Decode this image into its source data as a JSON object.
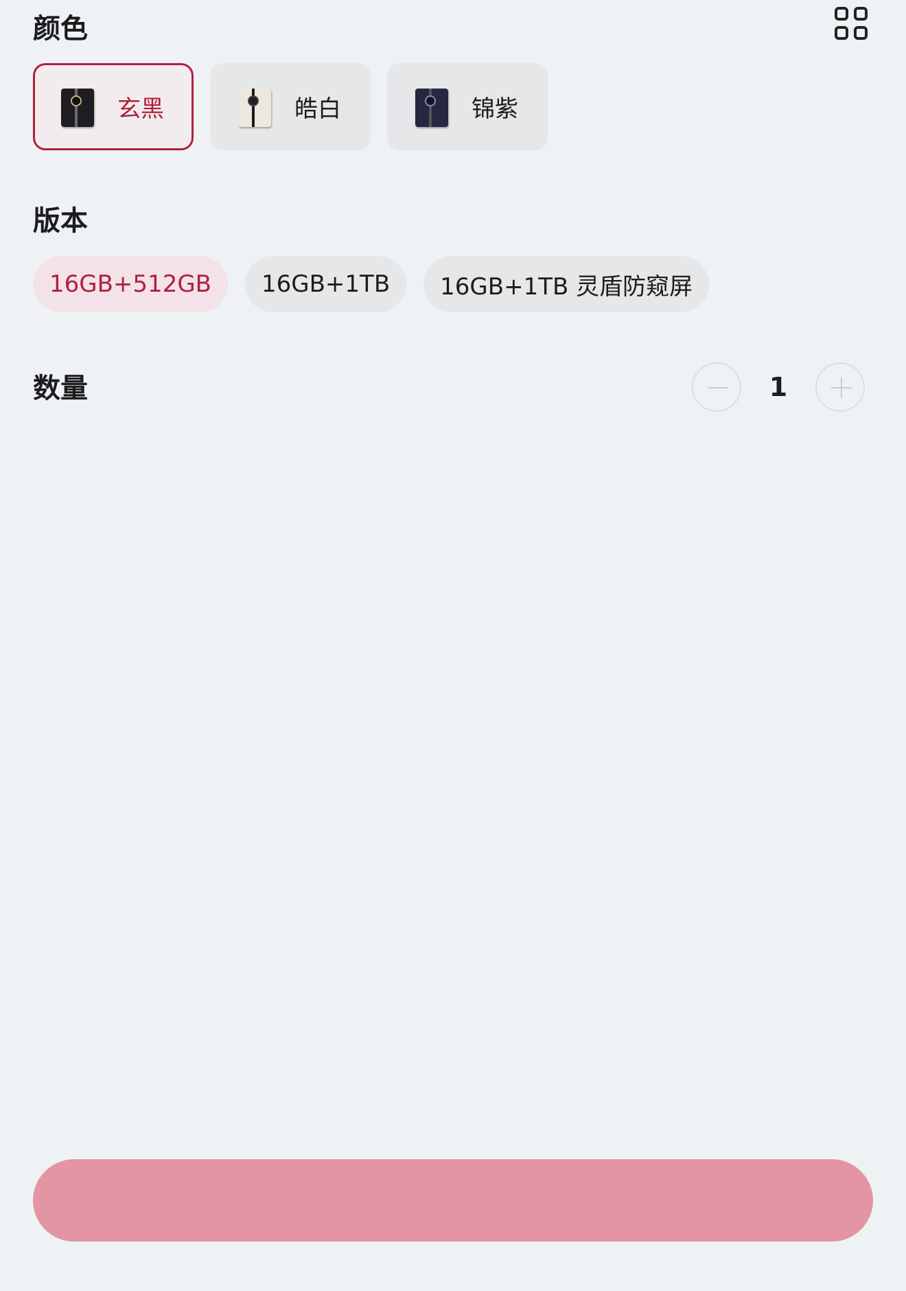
{
  "color_section": {
    "title": "颜色",
    "options": [
      {
        "label": "玄黑",
        "selected": true
      },
      {
        "label": "皓白",
        "selected": false
      },
      {
        "label": "锦紫",
        "selected": false
      }
    ]
  },
  "version_section": {
    "title": "版本",
    "options": [
      {
        "label": "16GB+512GB",
        "selected": true
      },
      {
        "label": "16GB+1TB",
        "selected": false
      },
      {
        "label": "16GB+1TB 灵盾防窥屏",
        "selected": false
      }
    ]
  },
  "quantity_section": {
    "title": "数量",
    "value": "1"
  },
  "buy_button": {
    "label": ""
  },
  "colors": {
    "accent": "#b01f3e",
    "background": "#eff2f4",
    "chip_background": "#e5e7e9",
    "button_background": "#e395a3"
  },
  "icons": {
    "top_right": "grid-icon",
    "stepper_minus": "minus-icon",
    "stepper_plus": "plus-icon"
  }
}
